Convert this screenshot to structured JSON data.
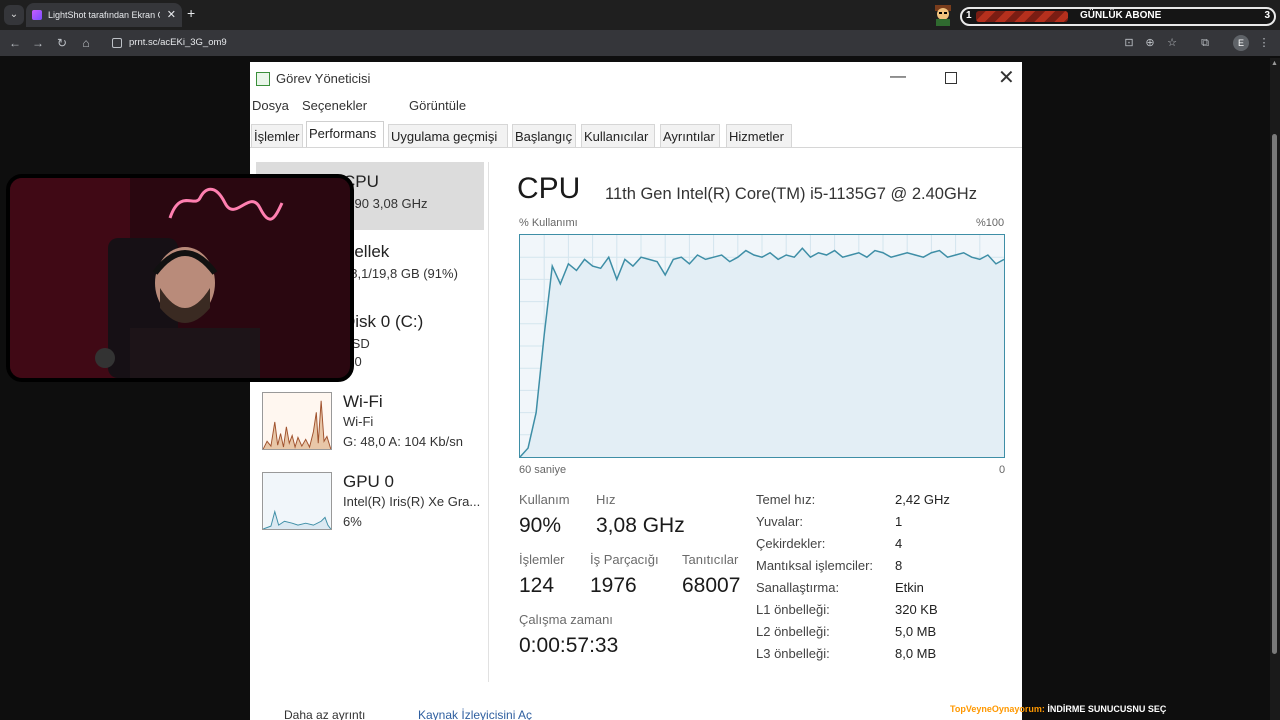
{
  "browser": {
    "tab_title": "LightShot tarafından Ekran Görü",
    "url": "prnt.sc/acEKi_3G_om9",
    "profile_initial": "E"
  },
  "stream_overlay": {
    "subscriber_count_left": "1",
    "subscriber_label": "GÜNLÜK ABONE",
    "subscriber_count_right": "3",
    "ticker_brand": "TopVeyneOynayorum:",
    "ticker_text": "İNDİRME SUNUCUSNU SEÇ"
  },
  "task_manager": {
    "title": "Görev Yöneticisi",
    "menu": [
      "Dosya",
      "Seçenekler",
      "Görüntüle"
    ],
    "tabs": [
      "İşlemler",
      "Performans",
      "Uygulama geçmişi",
      "Başlangıç",
      "Kullanıcılar",
      "Ayrıntılar",
      "Hizmetler"
    ],
    "active_tab": "Performans",
    "sidebar": {
      "cpu": {
        "name": "CPU",
        "detail": "%90  3,08 GHz"
      },
      "memory": {
        "name": "Bellek",
        "detail": "18,1/19,8 GB (91%)"
      },
      "disk": {
        "name": "Disk 0 (C:)",
        "detail1": "SSD",
        "detail2": "%0"
      },
      "wifi": {
        "name": "Wi-Fi",
        "detail1": "Wi-Fi",
        "detail2": "G: 48,0  A: 104 Kb/sn"
      },
      "gpu": {
        "name": "GPU 0",
        "detail1": "Intel(R) Iris(R) Xe Gra...",
        "detail2": "6%"
      }
    },
    "cpu_panel": {
      "heading": "CPU",
      "model": "11th Gen Intel(R) Core(TM) i5-1135G7 @ 2.40GHz",
      "graph_top_left": "% Kullanımı",
      "graph_top_right": "%100",
      "graph_bottom_left": "60 saniye",
      "graph_bottom_right": "0",
      "stats": {
        "usage_label": "Kullanım",
        "usage_value": "90%",
        "speed_label": "Hız",
        "speed_value": "3,08 GHz",
        "processes_label": "İşlemler",
        "processes_value": "124",
        "threads_label": "İş Parçacığı",
        "threads_value": "1976",
        "handles_label": "Tanıtıcılar",
        "handles_value": "68007",
        "uptime_label": "Çalışma zamanı",
        "uptime_value": "0:00:57:33"
      },
      "specs": [
        {
          "k": "Temel hız:",
          "v": "2,42 GHz"
        },
        {
          "k": "Yuvalar:",
          "v": "1"
        },
        {
          "k": "Çekirdekler:",
          "v": "4"
        },
        {
          "k": "Mantıksal işlemciler:",
          "v": "8"
        },
        {
          "k": "Sanallaştırma:",
          "v": "Etkin"
        },
        {
          "k": "L1 önbelleği:",
          "v": "320 KB"
        },
        {
          "k": "L2 önbelleği:",
          "v": "5,0 MB"
        },
        {
          "k": "L3 önbelleği:",
          "v": "8,0 MB"
        }
      ],
      "usage_history_pct": [
        0,
        4,
        20,
        55,
        86,
        78,
        87,
        84,
        89,
        86,
        85,
        90,
        80,
        89,
        86,
        90,
        89,
        88,
        82,
        89,
        90,
        87,
        91,
        89,
        90,
        91,
        88,
        90,
        93,
        91,
        90,
        92,
        89,
        91,
        90,
        94,
        90,
        92,
        91,
        93,
        90,
        91,
        92,
        90,
        93,
        92,
        90,
        91,
        92,
        91,
        90,
        92,
        93,
        90,
        91,
        92,
        90,
        89,
        91,
        87,
        89
      ]
    },
    "footer": {
      "fewer_details": "Daha az ayrıntı",
      "resource_monitor": "Kaynak İzleyicisini Aç"
    }
  }
}
